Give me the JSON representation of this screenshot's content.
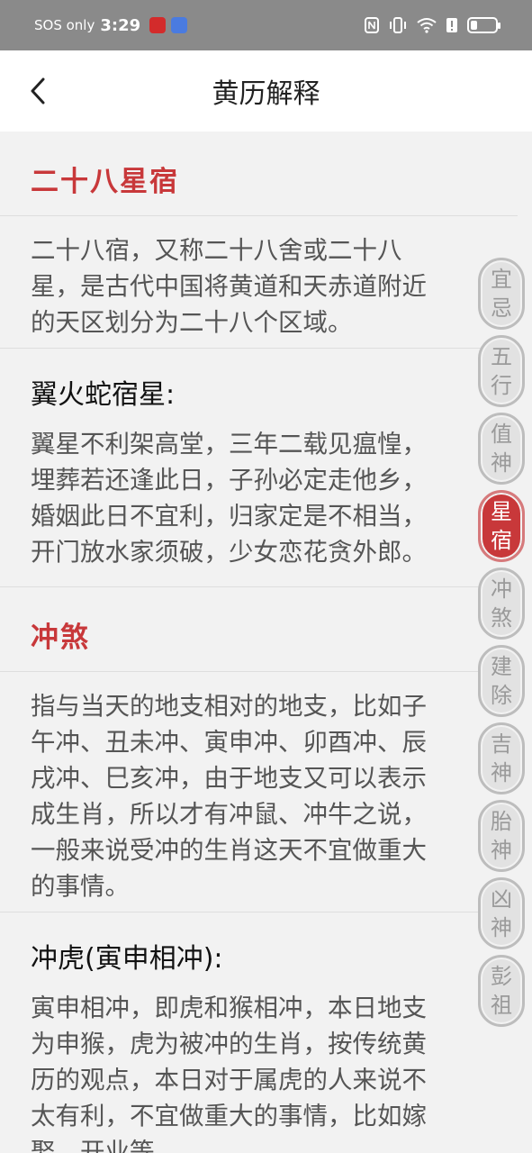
{
  "status_bar": {
    "carrier": "SOS only",
    "time": "3:29",
    "icons": [
      "nfc-icon",
      "vibrate-icon",
      "wifi-icon",
      "alert-icon",
      "battery-icon"
    ]
  },
  "header": {
    "title": "黄历解释",
    "back_icon": "chevron-left-icon"
  },
  "sections": {
    "xingxiu": {
      "title": "二十八星宿",
      "description": "二十八宿，又称二十八舍或二十八星，是古代中国将黄道和天赤道附近的天区划分为二十八个区域。",
      "entry_title": "翼火蛇宿星:",
      "entry_text": "翼星不利架高堂，三年二载见瘟惶，埋葬若还逢此日，子孙必定走他乡，婚姻此日不宜利，归家定是不相当，开门放水家须破，少女恋花贪外郎。"
    },
    "chongsha": {
      "title": "冲煞",
      "description": "指与当天的地支相对的地支，比如子午冲、丑未冲、寅申冲、卯酉冲、辰戌冲、巳亥冲，由于地支又可以表示成生肖，所以才有冲鼠、冲牛之说，一般来说受冲的生肖这天不宜做重大的事情。",
      "entry_title": "冲虎(寅申相冲):",
      "entry_text": "寅申相冲，即虎和猴相冲，本日地支为申猴，虎为被冲的生肖，按传统黄历的观点，本日对于属虎的人来说不太有利，不宜做重大的事情，比如嫁娶、开业等。"
    }
  },
  "side_nav": {
    "active_index": 3,
    "items": [
      {
        "label": "宜忌"
      },
      {
        "label": "五行"
      },
      {
        "label": "值神"
      },
      {
        "label": "星宿"
      },
      {
        "label": "冲煞"
      },
      {
        "label": "建除"
      },
      {
        "label": "吉神"
      },
      {
        "label": "胎神"
      },
      {
        "label": "凶神"
      },
      {
        "label": "彭祖"
      }
    ]
  },
  "colors": {
    "accent": "#c8383a",
    "status_bar": "#8a8a8a",
    "background": "#f2f2f2"
  }
}
